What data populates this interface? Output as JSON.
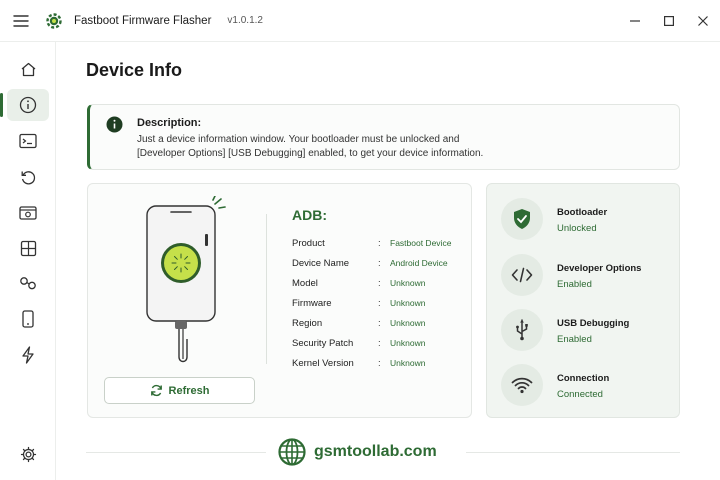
{
  "app": {
    "title": "Fastboot Firmware Flasher",
    "version": "v1.0.1.2"
  },
  "sidebar": {
    "items": [
      {
        "icon": "home-icon"
      },
      {
        "icon": "info-icon",
        "active": true
      },
      {
        "icon": "terminal-icon"
      },
      {
        "icon": "reset-icon"
      },
      {
        "icon": "camera-icon"
      },
      {
        "icon": "grid-icon"
      },
      {
        "icon": "link-icon"
      },
      {
        "icon": "phone-icon"
      },
      {
        "icon": "lightning-icon"
      },
      {
        "icon": "gear-icon"
      }
    ]
  },
  "page": {
    "title": "Device Info"
  },
  "description": {
    "heading": "Description:",
    "line1": "Just a device information window. Your bootloader must be unlocked and",
    "line2": "[Developer Options] [USB Debugging] enabled, to get your device information."
  },
  "adb": {
    "title": "ADB:",
    "rows": [
      {
        "label": "Product",
        "value": "Fastboot Device"
      },
      {
        "label": "Device Name",
        "value": "Android Device"
      },
      {
        "label": "Model",
        "value": "Unknown"
      },
      {
        "label": "Firmware",
        "value": "Unknown"
      },
      {
        "label": "Region",
        "value": "Unknown"
      },
      {
        "label": "Security Patch",
        "value": "Unknown"
      },
      {
        "label": "Kernel Version",
        "value": "Unknown"
      }
    ],
    "colon": ":"
  },
  "refresh": {
    "label": "Refresh"
  },
  "status": [
    {
      "label": "Bootloader",
      "value": "Unlocked",
      "icon": "shield-check-icon"
    },
    {
      "label": "Developer Options",
      "value": "Enabled",
      "icon": "code-icon"
    },
    {
      "label": "USB Debugging",
      "value": "Enabled",
      "icon": "usb-icon"
    },
    {
      "label": "Connection",
      "value": "Connected",
      "icon": "wifi-icon"
    }
  ],
  "footer": {
    "brand": "gsmtoollab.com"
  },
  "colors": {
    "accent": "#2e6b34",
    "kiwi": "#c5e04a"
  }
}
